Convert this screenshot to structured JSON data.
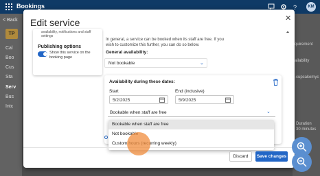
{
  "app": {
    "title": "Bookings",
    "avatar_initials": "KM"
  },
  "leftnav": {
    "back_label": "< Back",
    "tp_label": "TP",
    "items": [
      "Cal",
      "Boo",
      "Cus",
      "Sta",
      "Serv",
      "Bus",
      "Intc"
    ]
  },
  "right_bg": {
    "fragments": [
      "quirement",
      "ailability",
      "-cupcakemyc",
      "Duration",
      "30 minutes"
    ]
  },
  "modal": {
    "title": "Edit service",
    "close_icon": "close-icon",
    "card": {
      "truncated_text": "availability, notifications and staff settings",
      "publishing_title": "Publishing options",
      "toggle_on": true,
      "toggle_desc": "Show this service on the booking page"
    },
    "intro_text": "In general, a service can be booked when its staff are free. If you wish to customize this further, you can do so below.",
    "general_availability": {
      "label": "General availability:",
      "value": "Not bookable"
    },
    "panel": {
      "title": "Availability during these dates:",
      "start_label": "Start",
      "start_value": "5/2/2025",
      "end_label": "End (inclusive)",
      "end_value": "5/9/2025",
      "select_value": "Bookable when staff are free",
      "options": [
        {
          "label": "Bookable when staff are free",
          "selected": true
        },
        {
          "label": "Not bookable",
          "selected": false
        },
        {
          "label": "Custom hours (recurring weekly)",
          "selected": false
        }
      ]
    },
    "footer": {
      "discard_label": "Discard",
      "save_label": "Save changes"
    }
  },
  "colors": {
    "accent": "#2266c6",
    "topbar": "#0f3a66",
    "pointer": "#f08c3c",
    "zoom": "#5b8fd0"
  }
}
